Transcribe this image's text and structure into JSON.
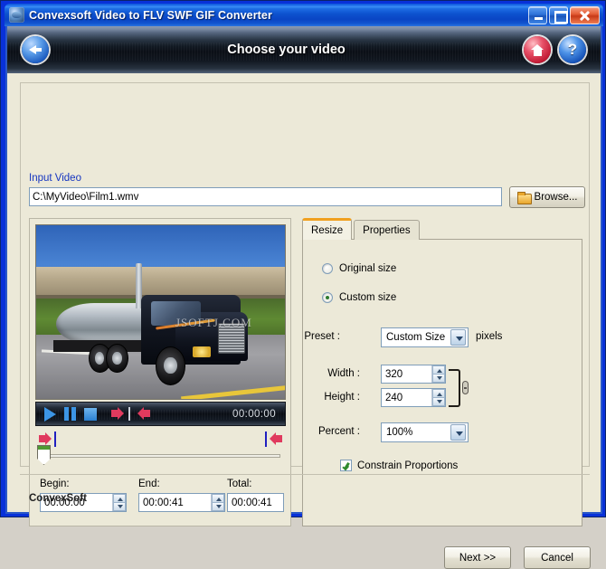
{
  "window": {
    "title": "Convexsoft Video to FLV  SWF  GIF Converter",
    "icon": "app-globe-icon",
    "buttons": {
      "minimize": "minimize",
      "maximize": "maximize",
      "close": "close"
    }
  },
  "banner": {
    "title": "Choose your video",
    "back_icon": "back-arrow-icon",
    "home_icon": "home-icon",
    "help_label": "?"
  },
  "input": {
    "label": "Input Video",
    "value": "C:\\MyVideo\\Film1.wmv",
    "placeholder": "",
    "browse_label": "Browse..."
  },
  "preview": {
    "watermark": "JSOFTJ.COM",
    "playback": {
      "play": "play-icon",
      "pause": "pause-icon",
      "stop": "stop-icon",
      "mark_in": "mark-in-icon",
      "mark_out": "mark-out-icon",
      "time": "00:00:00"
    },
    "trim": {
      "in_icon": "trim-in-marker-icon",
      "out_icon": "trim-out-marker-icon",
      "slider": "position-slider"
    },
    "fields": [
      {
        "label": "Begin:",
        "value": "00:00:00",
        "spinner": true
      },
      {
        "label": "End:",
        "value": "00:00:41",
        "spinner": true
      },
      {
        "label": "Total:",
        "value": "00:00:41",
        "spinner": false
      }
    ]
  },
  "tabs": {
    "active": "Resize",
    "items": [
      {
        "label": "Resize",
        "active": true
      },
      {
        "label": "Properties",
        "active": false
      }
    ]
  },
  "resize": {
    "size_mode": "custom",
    "original_size_label": "Original size",
    "custom_size_label": "Custom size",
    "preset_label": "Preset :",
    "preset_value": "Custom Size",
    "pixels_label": "pixels",
    "width_label": "Width :",
    "width_value": "320",
    "height_label": "Height :",
    "height_value": "240",
    "percent_label": "Percent :",
    "percent_value": "100%",
    "constrain_label": "Constrain Proportions",
    "constrain_checked": true,
    "link_icon": "chain-link-icon"
  },
  "footer": {
    "brand": "ConvexSoft",
    "next_label": "Next >>",
    "cancel_label": "Cancel"
  },
  "colors": {
    "title_bar": "#0a56d6",
    "window_border": "#0831d9",
    "client_bg": "#ece9d8",
    "label_blue": "#1535c0",
    "tab_accent": "#f0a020",
    "close_button": "#c83a18"
  }
}
